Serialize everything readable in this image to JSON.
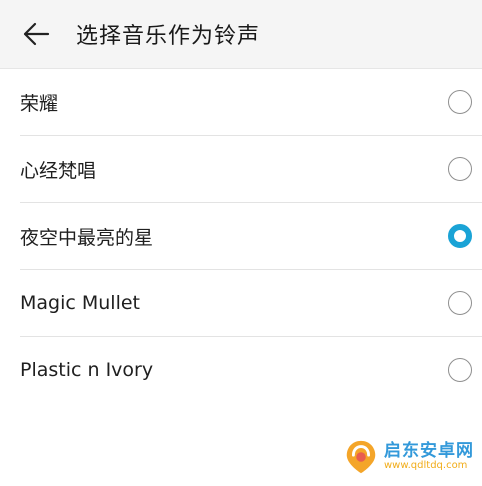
{
  "header": {
    "back_icon": "arrow-left-icon",
    "title": "选择音乐作为铃声"
  },
  "ringtones": [
    {
      "label": "荣耀",
      "selected": false
    },
    {
      "label": "心经梵唱",
      "selected": false
    },
    {
      "label": "夜空中最亮的星",
      "selected": true
    },
    {
      "label": "Magic Mullet",
      "selected": false
    },
    {
      "label": "Plastic n Ivory",
      "selected": false
    }
  ],
  "colors": {
    "accent": "#1aa3d6",
    "header_bg": "#f5f5f5",
    "divider": "#e3e3e3"
  },
  "watermark": {
    "name": "启东安卓网",
    "url": "www.qdltdq.com"
  }
}
